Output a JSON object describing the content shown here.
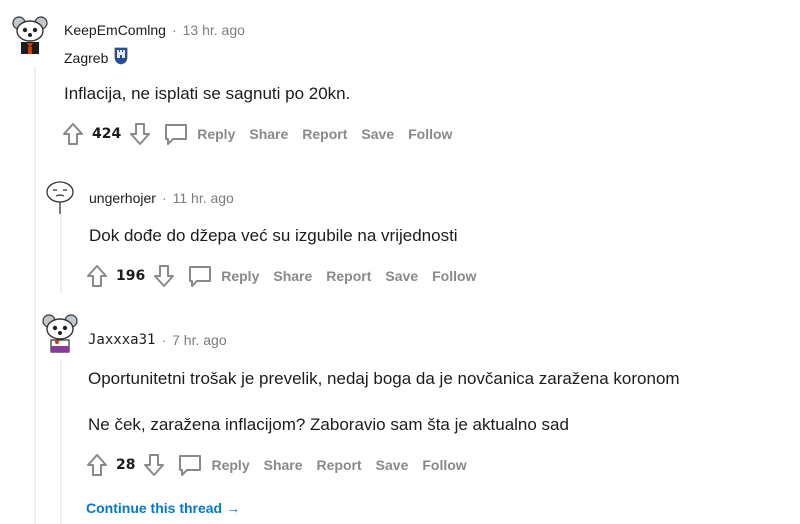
{
  "comments": [
    {
      "author": "KeepEmComlng",
      "time": "13 hr. ago",
      "flair": "Zagreb",
      "body": [
        "Inflacija, ne isplati se sagnuti po 20kn."
      ],
      "score": "424",
      "avatar_icon": "snoo-avatar-icon"
    },
    {
      "author": "ungerhojer",
      "time": "11 hr. ago",
      "body": [
        "Dok dođe do džepa već su izgubile na vrijednosti"
      ],
      "score": "196",
      "avatar_icon": "snoo-outline-avatar-icon"
    },
    {
      "author": "Jaxxxa31",
      "time": "7 hr. ago",
      "body": [
        "Oportunitetni trošak je prevelik, nedaj boga da je novčanica zaražena koronom",
        "Ne ček, zaražena inflacijom? Zaboravio sam šta je aktualno sad"
      ],
      "score": "28",
      "avatar_icon": "snoo-avatar-icon"
    }
  ],
  "actions": {
    "separator": "·",
    "reply": "Reply",
    "share": "Share",
    "report": "Report",
    "save": "Save",
    "follow": "Follow"
  },
  "continue_thread": "Continue this thread",
  "continue_arrow": "→",
  "colors": {
    "meta_gray": "#7c7c7c",
    "action_gray": "#878a8c",
    "link_blue": "#0079d3",
    "thread_line": "#edeff1"
  }
}
